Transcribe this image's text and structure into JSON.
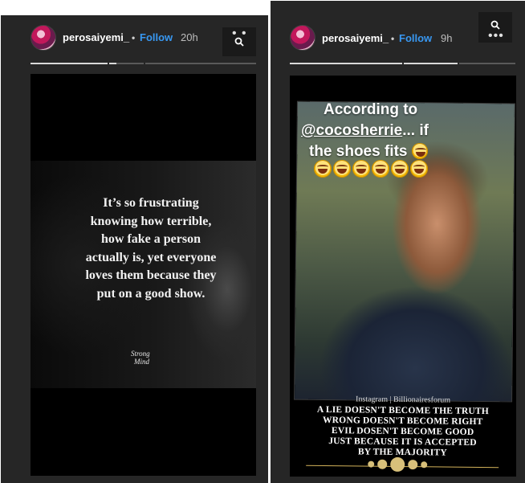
{
  "stories": [
    {
      "username": "perosaiyemi_",
      "separator": "•",
      "follow_label": "Follow",
      "time": "20h",
      "progress_segments": [
        1,
        0.2,
        0
      ],
      "quote_lines": [
        "It’s so frustrating",
        "knowing how terrible,",
        "how fake a person",
        "actually is, yet everyone",
        "loves them because they",
        "put on a good show."
      ],
      "signature_lines": [
        "Strong",
        "Mind"
      ]
    },
    {
      "username": "perosaiyemi_",
      "separator": "•",
      "follow_label": "Follow",
      "time": "9h",
      "progress_segments": [
        1,
        1,
        0
      ],
      "overlay_text": {
        "line1": "According to",
        "handle": "@cocosherrie",
        "after_handle": "... if",
        "line3": "the shoes fits"
      },
      "emoji": "grinning-sweat-emoji",
      "emoji_count": 7,
      "image_credit": "Instagram | Billionairesforum",
      "quote_lines": [
        "A LIE DOESN'T BECOME THE TRUTH",
        "WRONG DOESN'T  BECOME RIGHT",
        "EVIL DOSEN'T BECOME GOOD",
        "JUST BECAUSE IT IS ACCEPTED",
        "BY THE MAJORITY"
      ]
    }
  ],
  "icons": {
    "menu": "more-horizontal-icon",
    "search": "search-icon"
  },
  "colors": {
    "panel": "#262626",
    "follow": "#3897f0",
    "media_bg": "#000000"
  }
}
